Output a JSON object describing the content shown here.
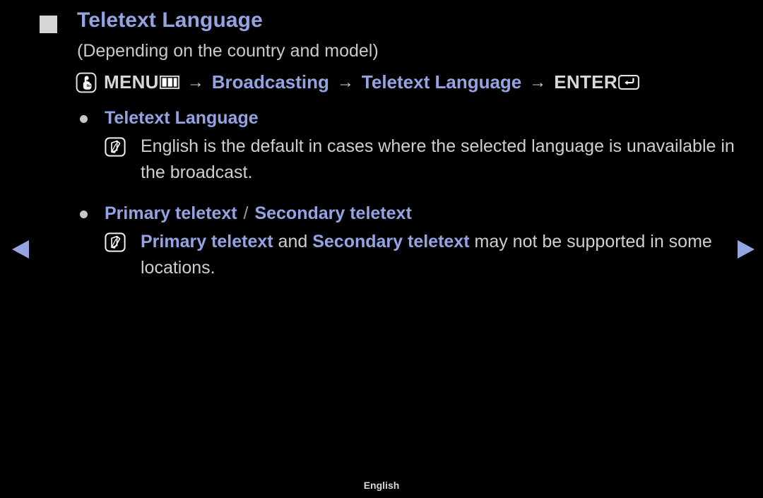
{
  "page": {
    "background_color": "#000000",
    "accent_blue": "#94a4e2",
    "body_text_color": "#cfcfcf"
  },
  "header": {
    "square_bullet_icon": "filled-square-icon",
    "title": "Teletext Language",
    "subtitle": "(Depending on the country and model)"
  },
  "menu_path": {
    "menu_button_icon": "menu-hand-press-icon",
    "menu_label": "MENU",
    "menu_bars_icon": "menu-bars-icon",
    "arrow_1": "→",
    "step_2": "Broadcasting",
    "arrow_2": "→",
    "step_3": "Teletext Language",
    "arrow_3": "→",
    "enter_label": "ENTER",
    "enter_key_icon": "enter-return-key-icon"
  },
  "sections": [
    {
      "bullet_icon": "bullet-dot-icon",
      "label": "Teletext Language",
      "label_parts": [
        {
          "text": "Teletext Language",
          "style": "blue-bold"
        }
      ],
      "note": {
        "icon": "note-pencil-icon",
        "parts": [
          {
            "text": "English is the default in cases where the selected language is unavailable in the broadcast.",
            "style": "regular"
          }
        ]
      }
    },
    {
      "bullet_icon": "bullet-dot-icon",
      "label": "Primary teletext / Secondary teletext",
      "label_parts": [
        {
          "text": "Primary teletext",
          "style": "blue-bold"
        },
        {
          "text": " / ",
          "style": "separator"
        },
        {
          "text": "Secondary teletext",
          "style": "blue-bold"
        }
      ],
      "note": {
        "icon": "note-pencil-icon",
        "parts": [
          {
            "text": "Primary teletext",
            "style": "blue-bold"
          },
          {
            "text": " and ",
            "style": "regular"
          },
          {
            "text": "Secondary teletext",
            "style": "blue-bold"
          },
          {
            "text": " may not be supported in some locations.",
            "style": "regular"
          }
        ]
      }
    }
  ],
  "navigation": {
    "previous_icon": "arrow-left-triangle-icon",
    "next_icon": "arrow-right-triangle-icon",
    "arrow_color": "#95a5e0"
  },
  "footer": {
    "language": "English"
  }
}
